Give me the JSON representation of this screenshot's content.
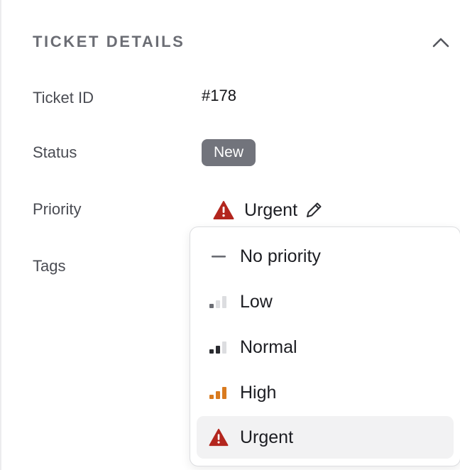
{
  "section": {
    "title": "TICKET DETAILS"
  },
  "fields": {
    "ticket_id_label": "Ticket ID",
    "ticket_id_value": "#178",
    "status_label": "Status",
    "status_value": "New",
    "priority_label": "Priority",
    "priority_value": "Urgent",
    "tags_label": "Tags"
  },
  "priority_menu": {
    "options": [
      {
        "label": "No priority",
        "icon": "dash-icon"
      },
      {
        "label": "Low",
        "icon": "signal-low-icon"
      },
      {
        "label": "Normal",
        "icon": "signal-normal-icon"
      },
      {
        "label": "High",
        "icon": "signal-high-icon"
      },
      {
        "label": "Urgent",
        "icon": "urgent-warning-icon"
      }
    ],
    "selected": "Urgent"
  },
  "colors": {
    "urgent": "#b3261e",
    "high": "#d97a1e",
    "status_badge": "#72747c"
  }
}
